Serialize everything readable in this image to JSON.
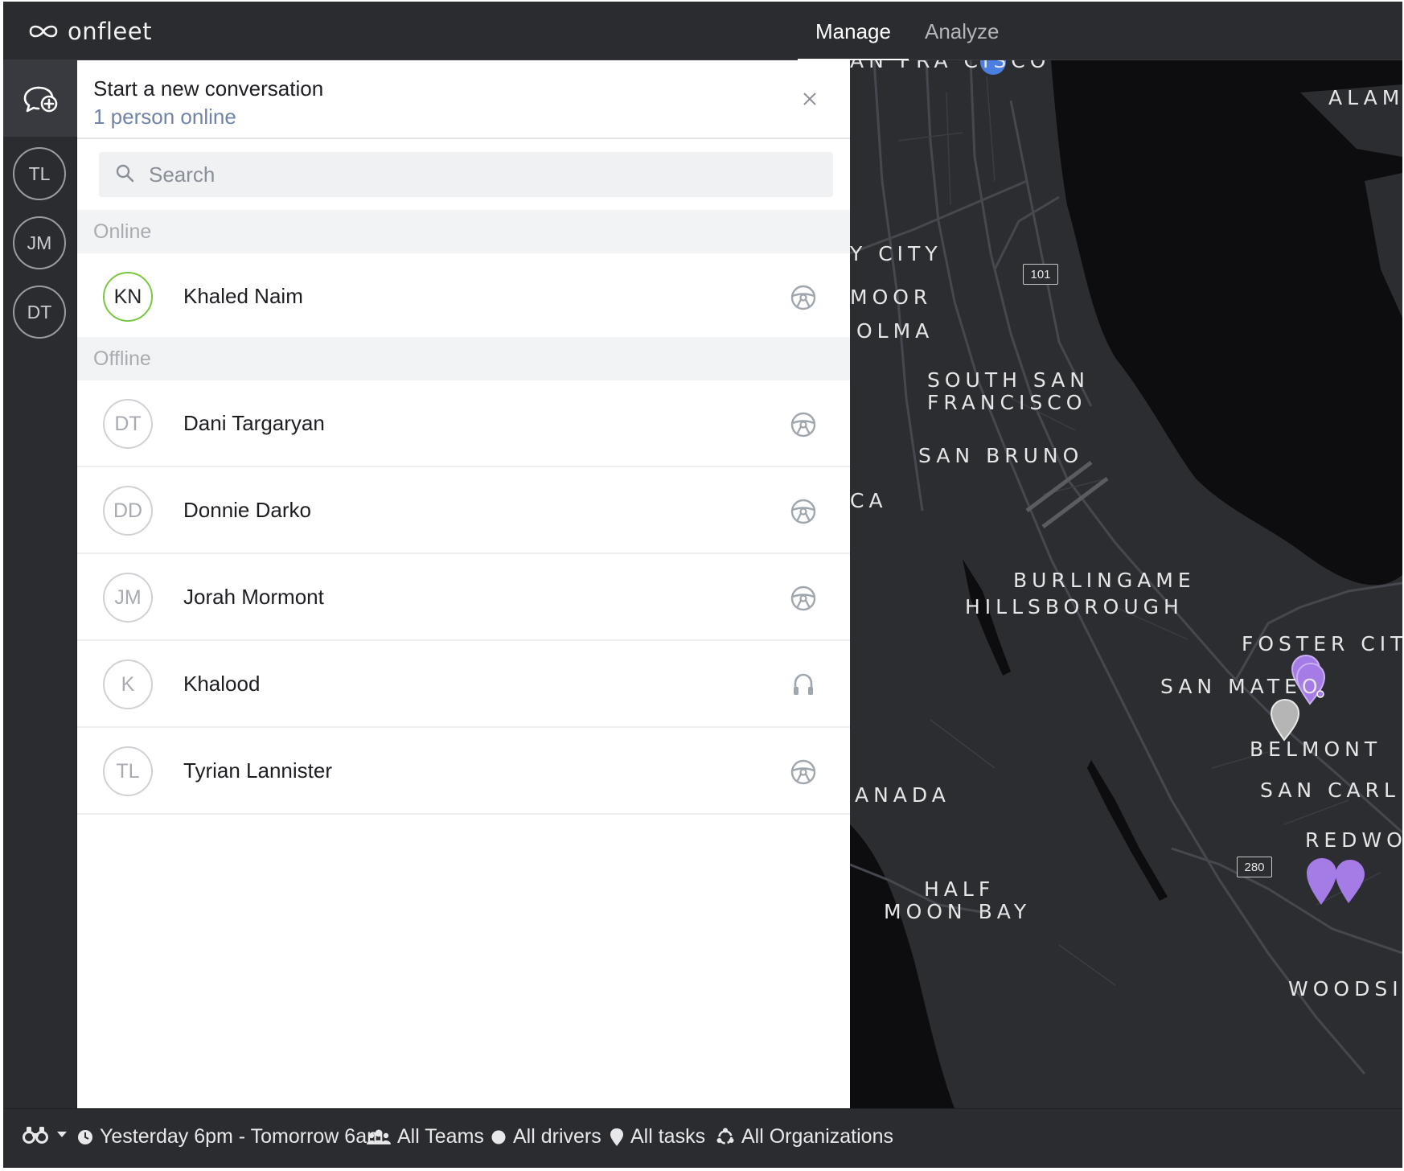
{
  "topbar": {
    "logo_text": "onfleet",
    "tabs": [
      {
        "label": "Manage",
        "active": true
      },
      {
        "label": "Analyze",
        "active": false
      }
    ]
  },
  "rail": {
    "compose_icon": "new-conversation-icon",
    "avatars": [
      "TL",
      "JM",
      "DT"
    ]
  },
  "panel": {
    "title": "Start a new conversation",
    "subtitle": "1 person online",
    "close_icon": "close-icon",
    "search": {
      "placeholder": "Search",
      "value": ""
    },
    "sections": {
      "online": "Online",
      "offline": "Offline"
    },
    "online_contacts": [
      {
        "initials": "KN",
        "name": "Khaled Naim",
        "role_icon": "steering-wheel-icon"
      }
    ],
    "offline_contacts": [
      {
        "initials": "DT",
        "name": "Dani Targaryan",
        "role_icon": "steering-wheel-icon"
      },
      {
        "initials": "DD",
        "name": "Donnie Darko",
        "role_icon": "steering-wheel-icon"
      },
      {
        "initials": "JM",
        "name": "Jorah Mormont",
        "role_icon": "steering-wheel-icon"
      },
      {
        "initials": "K",
        "name": "Khalood",
        "role_icon": "headset-icon"
      },
      {
        "initials": "TL",
        "name": "Tyrian Lannister",
        "role_icon": "steering-wheel-icon"
      }
    ]
  },
  "map": {
    "labels": {
      "san_francisco": "AN FRA CISCO",
      "alameda": "ALAM",
      "daly_city": "Y CITY",
      "colma_moor": "MOOR",
      "colma": "OLMA",
      "south_sf_1": "SOUTH SAN",
      "south_sf_2": "FRANCISCO",
      "san_bruno": "SAN BRUNO",
      "pacifica": "CA",
      "burlingame": "BURLINGAME",
      "hillsborough": "HILLSBOROUGH",
      "foster_city": "FOSTER CIT",
      "san_mateo": "SAN MATEO",
      "belmont": "BELMONT",
      "san_carlos": "SAN CARL",
      "redwood": "REDWO",
      "granada": "ANADA",
      "half_moon_bay_1": "HALF",
      "half_moon_bay_2": "MOON BAY",
      "woodside": "WOODSI"
    },
    "shields": {
      "us101": "101",
      "i280": "280"
    },
    "colors": {
      "land": "#2c2d31",
      "water": "#0d0d10",
      "roads": "#44464d",
      "pin_purple": "#a57be6",
      "pin_gray": "#b5b5b5",
      "pin_blue": "#4a7fe0"
    }
  },
  "bottombar": {
    "filters": [
      {
        "icon": "binoculars-icon",
        "label": ""
      },
      {
        "icon": "clock-icon",
        "label": "Yesterday 6pm - Tomorrow 6am"
      },
      {
        "icon": "teams-icon",
        "label": "All Teams"
      },
      {
        "icon": "driver-dot-icon",
        "label": "All drivers"
      },
      {
        "icon": "task-pin-icon",
        "label": "All tasks"
      },
      {
        "icon": "organizations-icon",
        "label": "All Organizations"
      }
    ]
  },
  "colors": {
    "accent_online": "#78c83e",
    "subtitle_blue": "#6f84a8",
    "chrome_dark": "#2b2c30"
  }
}
